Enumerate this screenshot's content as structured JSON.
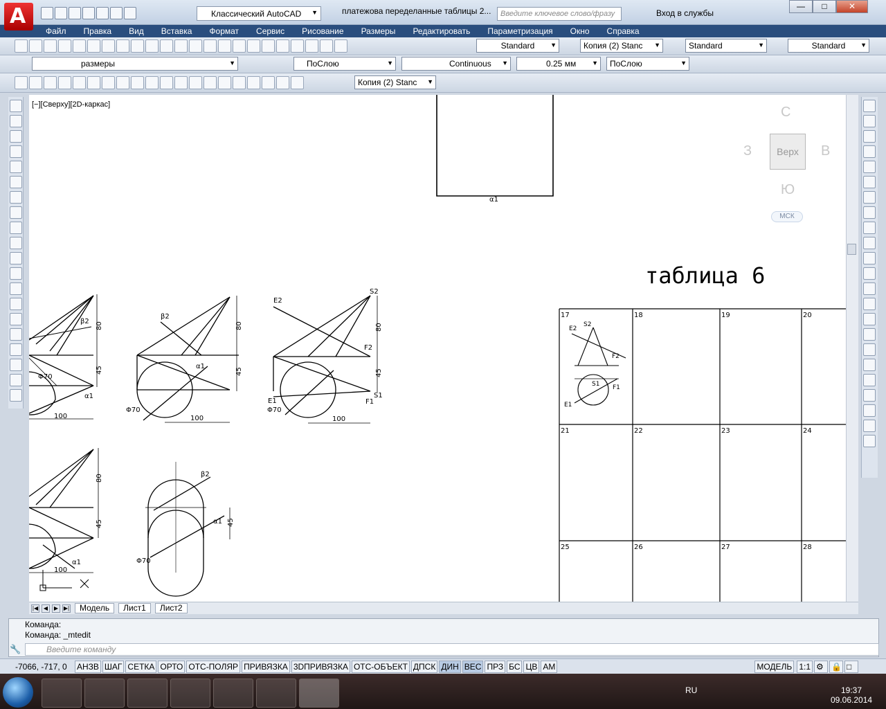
{
  "title": {
    "workspace": "Классический AutoCAD",
    "document": "платежова переделанные таблицы 2...",
    "search_placeholder": "Введите ключевое слово/фразу",
    "login": "Вход в службы"
  },
  "menu": [
    "Файл",
    "Правка",
    "Вид",
    "Вставка",
    "Формат",
    "Сервис",
    "Рисование",
    "Размеры",
    "Редактировать",
    "Параметризация",
    "Окно",
    "Справка"
  ],
  "styles": {
    "text_style": "Standard",
    "dim_style": "Копия (2) Stanc",
    "table_style": "Standard",
    "mleader_style": "Standard"
  },
  "layers": {
    "current_layer": "размеры",
    "color": "ПоСлою",
    "linetype": "Continuous",
    "lineweight": "0.25 мм",
    "plotstyle": "ПоСлою"
  },
  "dimbar": {
    "dim_style": "Копия (2) Stanc"
  },
  "viewport": {
    "label": "[−][Сверху][2D-каркас]"
  },
  "viewcube": {
    "top": "Верх",
    "north": "С",
    "south": "Ю",
    "west": "З",
    "east": "В",
    "ucs": "МСК"
  },
  "drawing": {
    "table_title": "таблица 6",
    "cells": [
      "17",
      "18",
      "19",
      "20",
      "21",
      "22",
      "23",
      "24",
      "25",
      "26",
      "27",
      "28"
    ],
    "labels": {
      "alpha1": "α1",
      "beta2": "β2",
      "e2": "E2",
      "s2": "S2",
      "f2": "F2",
      "e1": "E1",
      "s1": "S1",
      "f1": "F1",
      "dim80": "80",
      "dim45": "45",
      "dim100": "100",
      "phi70": "Φ70"
    }
  },
  "tabs": [
    "Модель",
    "Лист1",
    "Лист2"
  ],
  "command": {
    "line1": "Команда:",
    "line2": "Команда: _mtedit",
    "placeholder": "Введите команду"
  },
  "status": {
    "coords": "-7066, -717, 0",
    "buttons": [
      "АНЗВ",
      "ШАГ",
      "СЕТКА",
      "ОРТО",
      "ОТС-ПОЛЯР",
      "ПРИВЯЗКА",
      "3DПРИВЯЗКА",
      "ОТС-ОБЪЕКТ",
      "ДПСК",
      "ДИН",
      "ВЕС",
      "ПРЗ",
      "БС",
      "ЦВ",
      "АМ"
    ],
    "model": "МОДЕЛЬ",
    "scale": "1:1"
  },
  "taskbar": {
    "lang": "RU",
    "time": "19:37",
    "date": "09.06.2014"
  }
}
